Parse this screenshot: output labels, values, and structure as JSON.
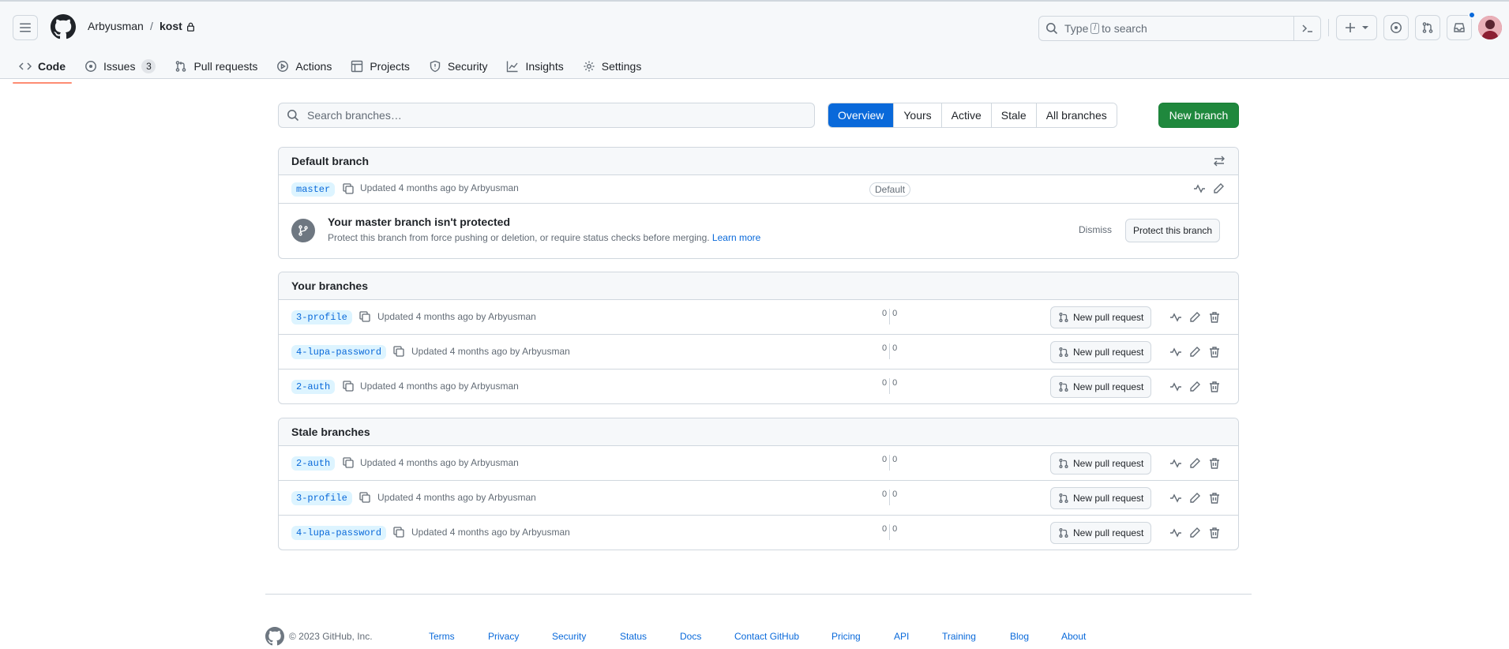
{
  "header": {
    "owner": "Arbyusman",
    "separator": "/",
    "repo": "kost",
    "search_prefix": "Type",
    "search_key": "/",
    "search_suffix": "to search"
  },
  "nav": {
    "tabs": [
      {
        "label": "Code",
        "icon": "code-icon"
      },
      {
        "label": "Issues",
        "icon": "issue-icon",
        "count": "3"
      },
      {
        "label": "Pull requests",
        "icon": "pull-request-icon"
      },
      {
        "label": "Actions",
        "icon": "play-icon"
      },
      {
        "label": "Projects",
        "icon": "table-icon"
      },
      {
        "label": "Security",
        "icon": "shield-icon"
      },
      {
        "label": "Insights",
        "icon": "graph-icon"
      },
      {
        "label": "Settings",
        "icon": "gear-icon"
      }
    ]
  },
  "filters": {
    "search_placeholder": "Search branches…",
    "tabs": [
      "Overview",
      "Yours",
      "Active",
      "Stale",
      "All branches"
    ],
    "active_tab": "Overview",
    "new_branch_label": "New branch"
  },
  "default_branch": {
    "title": "Default branch",
    "name": "master",
    "meta": "Updated 4 months ago by Arbyusman",
    "badge": "Default",
    "protection_title": "Your master branch isn't protected",
    "protection_text": "Protect this branch from force pushing or deletion, or require status checks before merging.",
    "learn_more": "Learn more",
    "dismiss": "Dismiss",
    "protect_button": "Protect this branch"
  },
  "your_branches": {
    "title": "Your branches",
    "rows": [
      {
        "name": "3-profile",
        "meta": "Updated 4 months ago by Arbyusman",
        "behind": "0",
        "ahead": "0",
        "pr_label": "New pull request"
      },
      {
        "name": "4-lupa-password",
        "meta": "Updated 4 months ago by Arbyusman",
        "behind": "0",
        "ahead": "0",
        "pr_label": "New pull request"
      },
      {
        "name": "2-auth",
        "meta": "Updated 4 months ago by Arbyusman",
        "behind": "0",
        "ahead": "0",
        "pr_label": "New pull request"
      }
    ]
  },
  "stale_branches": {
    "title": "Stale branches",
    "rows": [
      {
        "name": "2-auth",
        "meta": "Updated 4 months ago by Arbyusman",
        "behind": "0",
        "ahead": "0",
        "pr_label": "New pull request"
      },
      {
        "name": "3-profile",
        "meta": "Updated 4 months ago by Arbyusman",
        "behind": "0",
        "ahead": "0",
        "pr_label": "New pull request"
      },
      {
        "name": "4-lupa-password",
        "meta": "Updated 4 months ago by Arbyusman",
        "behind": "0",
        "ahead": "0",
        "pr_label": "New pull request"
      }
    ]
  },
  "footer": {
    "copyright": "© 2023 GitHub, Inc.",
    "links": [
      "Terms",
      "Privacy",
      "Security",
      "Status",
      "Docs",
      "Contact GitHub",
      "Pricing",
      "API",
      "Training",
      "Blog",
      "About"
    ]
  },
  "colors": {
    "primary_blue": "#0969da",
    "green_button": "#1f883d",
    "underline_orange": "#fd8c73",
    "notification_dot": "#0969da"
  }
}
